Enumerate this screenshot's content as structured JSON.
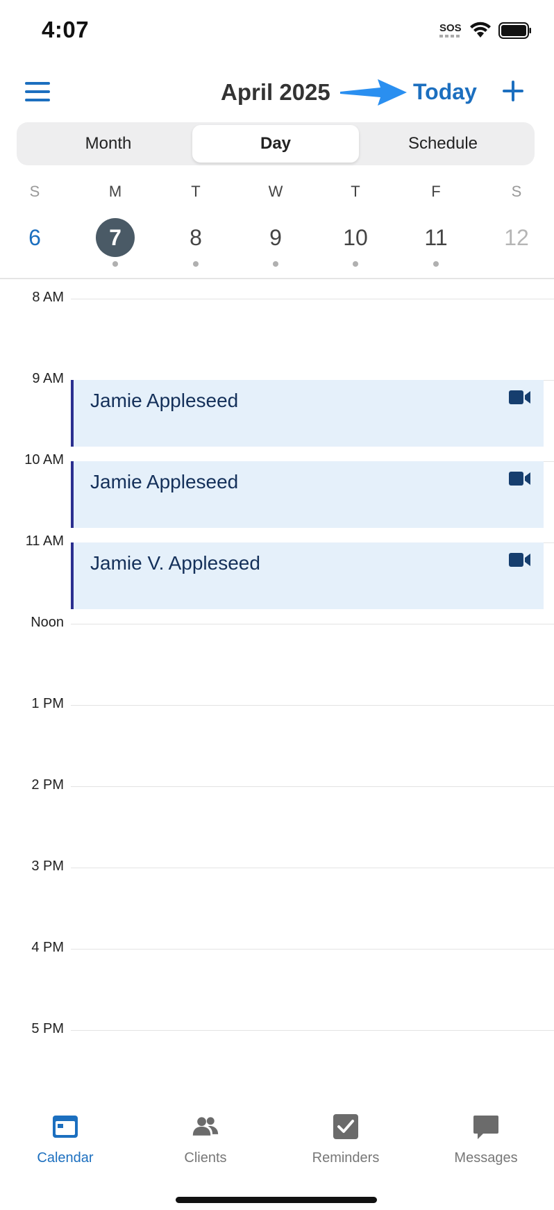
{
  "status_bar": {
    "time": "4:07",
    "sos": "SOS"
  },
  "header": {
    "title": "April 2025",
    "today_label": "Today",
    "menu_icon": "hamburger-menu-icon",
    "add_icon": "plus-icon",
    "accent": "#1c6fbf"
  },
  "view_tabs": [
    {
      "label": "Month",
      "active": false
    },
    {
      "label": "Day",
      "active": true
    },
    {
      "label": "Schedule",
      "active": false
    }
  ],
  "week": [
    {
      "letter": "S",
      "day": "6",
      "kind": "sunday",
      "has_event": false
    },
    {
      "letter": "M",
      "day": "7",
      "kind": "selected",
      "has_event": true
    },
    {
      "letter": "T",
      "day": "8",
      "kind": "weekday",
      "has_event": true
    },
    {
      "letter": "W",
      "day": "9",
      "kind": "weekday",
      "has_event": true
    },
    {
      "letter": "T",
      "day": "10",
      "kind": "weekday",
      "has_event": true
    },
    {
      "letter": "F",
      "day": "11",
      "kind": "weekday",
      "has_event": true
    },
    {
      "letter": "S",
      "day": "12",
      "kind": "saturday",
      "has_event": false
    }
  ],
  "hours": [
    "8 AM",
    "9 AM",
    "10 AM",
    "11 AM",
    "Noon",
    "1 PM",
    "2 PM",
    "3 PM",
    "4 PM",
    "5 PM"
  ],
  "events": [
    {
      "title": "Jamie Appleseed",
      "icon": "video-camera-icon"
    },
    {
      "title": "Jamie Appleseed",
      "icon": "video-camera-icon"
    },
    {
      "title": "Jamie V. Appleseed",
      "icon": "video-camera-icon"
    }
  ],
  "tabbar": [
    {
      "label": "Calendar",
      "icon": "calendar-icon",
      "active": true
    },
    {
      "label": "Clients",
      "icon": "people-icon",
      "active": false
    },
    {
      "label": "Reminders",
      "icon": "checkbox-icon",
      "active": false
    },
    {
      "label": "Messages",
      "icon": "chat-bubble-icon",
      "active": false
    }
  ]
}
